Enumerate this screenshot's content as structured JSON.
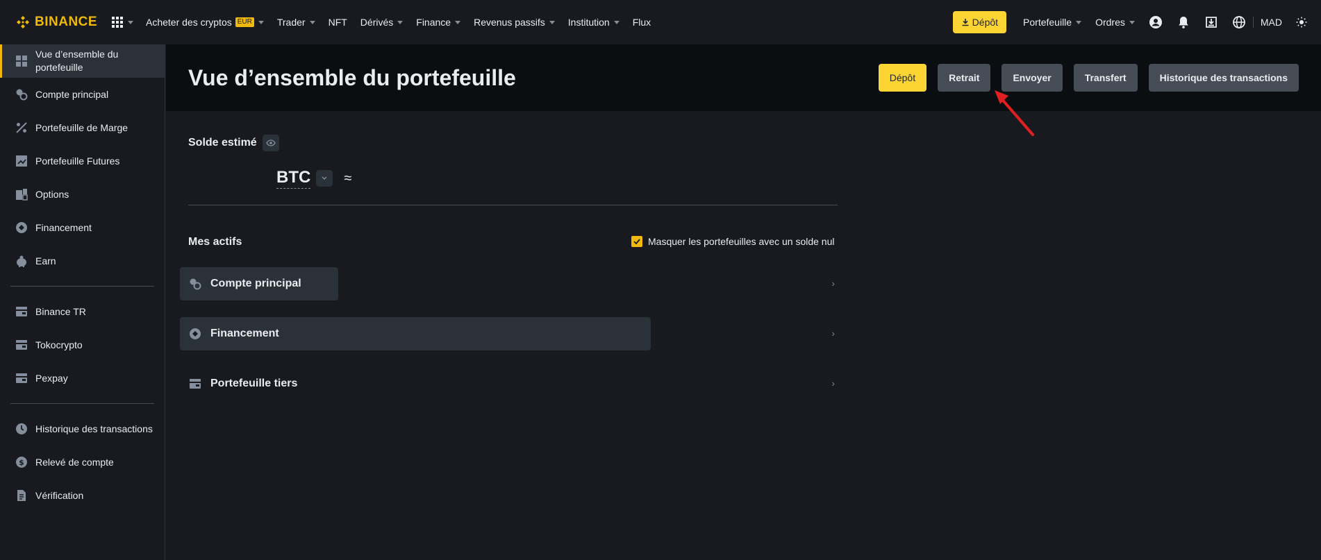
{
  "topnav": {
    "logo_text": "BINANCE",
    "items": [
      {
        "label": "Acheter des cryptos",
        "badge": "EUR"
      },
      {
        "label": "Trader"
      },
      {
        "label": "NFT"
      },
      {
        "label": "Dérivés"
      },
      {
        "label": "Finance"
      },
      {
        "label": "Revenus passifs"
      },
      {
        "label": "Institution"
      },
      {
        "label": "Flux"
      }
    ],
    "depot_label": "Dépôt",
    "portefeuille_label": "Portefeuille",
    "ordres_label": "Ordres",
    "currency": "MAD",
    "icons": [
      "user-icon",
      "bell-icon",
      "download-app-icon",
      "globe-icon",
      "theme-icon"
    ]
  },
  "sidebar": {
    "items": [
      {
        "label": "Vue d’ensemble du portefeuille",
        "icon": "grid-icon"
      },
      {
        "label": "Compte principal",
        "icon": "spot-account-icon"
      },
      {
        "label": "Portefeuille de Marge",
        "icon": "margin-icon"
      },
      {
        "label": "Portefeuille Futures",
        "icon": "futures-icon"
      },
      {
        "label": "Options",
        "icon": "options-icon"
      },
      {
        "label": "Financement",
        "icon": "funding-icon"
      },
      {
        "label": "Earn",
        "icon": "earn-icon"
      },
      {
        "label": "Binance TR",
        "icon": "wallet-icon"
      },
      {
        "label": "Tokocrypto",
        "icon": "wallet-icon"
      },
      {
        "label": "Pexpay",
        "icon": "wallet-icon"
      },
      {
        "label": "Historique des transactions",
        "icon": "history-icon"
      },
      {
        "label": "Relevé de compte",
        "icon": "dollar-icon"
      },
      {
        "label": "Vérification",
        "icon": "document-icon"
      }
    ]
  },
  "header": {
    "title": "Vue d’ensemble du portefeuille",
    "actions": [
      "Dépôt",
      "Retrait",
      "Envoyer",
      "Transfert",
      "Historique des transactions"
    ]
  },
  "balance": {
    "title": "Solde estimé",
    "currency": "BTC",
    "approx": "≈"
  },
  "assets": {
    "title": "Mes actifs",
    "hide_zero_label": "Masquer les portefeuilles avec un solde nul",
    "hide_zero_checked": true,
    "wallets": [
      {
        "label": "Compte principal",
        "icon": "spot-account-icon"
      },
      {
        "label": "Financement",
        "icon": "funding-icon"
      },
      {
        "label": "Portefeuille tiers",
        "icon": "wallet-icon"
      }
    ]
  },
  "colors": {
    "brand": "#f0b90b",
    "primary_button": "#fcd535",
    "background": "#181a20",
    "header_background": "#0b0e11",
    "secondary_button": "#474d57",
    "annotation_arrow": "#e02020"
  }
}
